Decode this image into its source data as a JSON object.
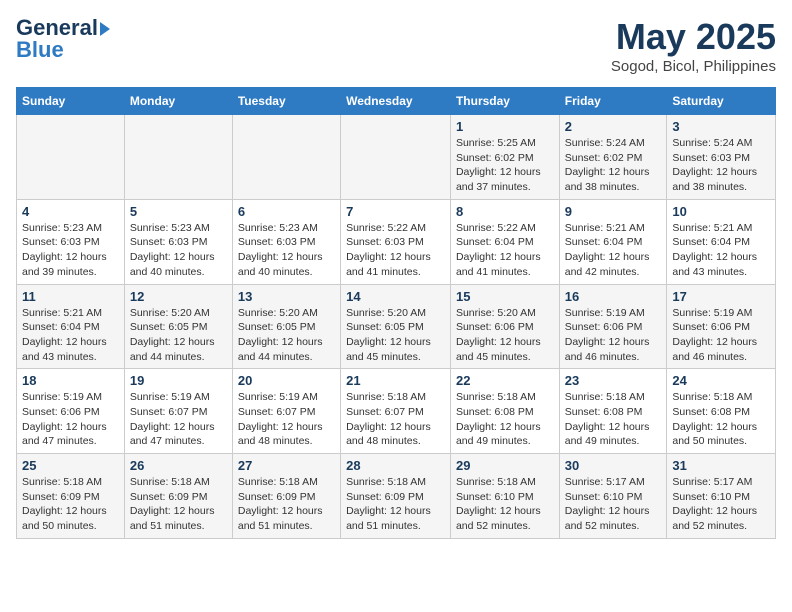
{
  "header": {
    "logo_line1": "General",
    "logo_line2": "Blue",
    "month": "May 2025",
    "location": "Sogod, Bicol, Philippines"
  },
  "weekdays": [
    "Sunday",
    "Monday",
    "Tuesday",
    "Wednesday",
    "Thursday",
    "Friday",
    "Saturday"
  ],
  "weeks": [
    [
      {
        "day": "",
        "text": ""
      },
      {
        "day": "",
        "text": ""
      },
      {
        "day": "",
        "text": ""
      },
      {
        "day": "",
        "text": ""
      },
      {
        "day": "1",
        "text": "Sunrise: 5:25 AM\nSunset: 6:02 PM\nDaylight: 12 hours\nand 37 minutes."
      },
      {
        "day": "2",
        "text": "Sunrise: 5:24 AM\nSunset: 6:02 PM\nDaylight: 12 hours\nand 38 minutes."
      },
      {
        "day": "3",
        "text": "Sunrise: 5:24 AM\nSunset: 6:03 PM\nDaylight: 12 hours\nand 38 minutes."
      }
    ],
    [
      {
        "day": "4",
        "text": "Sunrise: 5:23 AM\nSunset: 6:03 PM\nDaylight: 12 hours\nand 39 minutes."
      },
      {
        "day": "5",
        "text": "Sunrise: 5:23 AM\nSunset: 6:03 PM\nDaylight: 12 hours\nand 40 minutes."
      },
      {
        "day": "6",
        "text": "Sunrise: 5:23 AM\nSunset: 6:03 PM\nDaylight: 12 hours\nand 40 minutes."
      },
      {
        "day": "7",
        "text": "Sunrise: 5:22 AM\nSunset: 6:03 PM\nDaylight: 12 hours\nand 41 minutes."
      },
      {
        "day": "8",
        "text": "Sunrise: 5:22 AM\nSunset: 6:04 PM\nDaylight: 12 hours\nand 41 minutes."
      },
      {
        "day": "9",
        "text": "Sunrise: 5:21 AM\nSunset: 6:04 PM\nDaylight: 12 hours\nand 42 minutes."
      },
      {
        "day": "10",
        "text": "Sunrise: 5:21 AM\nSunset: 6:04 PM\nDaylight: 12 hours\nand 43 minutes."
      }
    ],
    [
      {
        "day": "11",
        "text": "Sunrise: 5:21 AM\nSunset: 6:04 PM\nDaylight: 12 hours\nand 43 minutes."
      },
      {
        "day": "12",
        "text": "Sunrise: 5:20 AM\nSunset: 6:05 PM\nDaylight: 12 hours\nand 44 minutes."
      },
      {
        "day": "13",
        "text": "Sunrise: 5:20 AM\nSunset: 6:05 PM\nDaylight: 12 hours\nand 44 minutes."
      },
      {
        "day": "14",
        "text": "Sunrise: 5:20 AM\nSunset: 6:05 PM\nDaylight: 12 hours\nand 45 minutes."
      },
      {
        "day": "15",
        "text": "Sunrise: 5:20 AM\nSunset: 6:06 PM\nDaylight: 12 hours\nand 45 minutes."
      },
      {
        "day": "16",
        "text": "Sunrise: 5:19 AM\nSunset: 6:06 PM\nDaylight: 12 hours\nand 46 minutes."
      },
      {
        "day": "17",
        "text": "Sunrise: 5:19 AM\nSunset: 6:06 PM\nDaylight: 12 hours\nand 46 minutes."
      }
    ],
    [
      {
        "day": "18",
        "text": "Sunrise: 5:19 AM\nSunset: 6:06 PM\nDaylight: 12 hours\nand 47 minutes."
      },
      {
        "day": "19",
        "text": "Sunrise: 5:19 AM\nSunset: 6:07 PM\nDaylight: 12 hours\nand 47 minutes."
      },
      {
        "day": "20",
        "text": "Sunrise: 5:19 AM\nSunset: 6:07 PM\nDaylight: 12 hours\nand 48 minutes."
      },
      {
        "day": "21",
        "text": "Sunrise: 5:18 AM\nSunset: 6:07 PM\nDaylight: 12 hours\nand 48 minutes."
      },
      {
        "day": "22",
        "text": "Sunrise: 5:18 AM\nSunset: 6:08 PM\nDaylight: 12 hours\nand 49 minutes."
      },
      {
        "day": "23",
        "text": "Sunrise: 5:18 AM\nSunset: 6:08 PM\nDaylight: 12 hours\nand 49 minutes."
      },
      {
        "day": "24",
        "text": "Sunrise: 5:18 AM\nSunset: 6:08 PM\nDaylight: 12 hours\nand 50 minutes."
      }
    ],
    [
      {
        "day": "25",
        "text": "Sunrise: 5:18 AM\nSunset: 6:09 PM\nDaylight: 12 hours\nand 50 minutes."
      },
      {
        "day": "26",
        "text": "Sunrise: 5:18 AM\nSunset: 6:09 PM\nDaylight: 12 hours\nand 51 minutes."
      },
      {
        "day": "27",
        "text": "Sunrise: 5:18 AM\nSunset: 6:09 PM\nDaylight: 12 hours\nand 51 minutes."
      },
      {
        "day": "28",
        "text": "Sunrise: 5:18 AM\nSunset: 6:09 PM\nDaylight: 12 hours\nand 51 minutes."
      },
      {
        "day": "29",
        "text": "Sunrise: 5:18 AM\nSunset: 6:10 PM\nDaylight: 12 hours\nand 52 minutes."
      },
      {
        "day": "30",
        "text": "Sunrise: 5:17 AM\nSunset: 6:10 PM\nDaylight: 12 hours\nand 52 minutes."
      },
      {
        "day": "31",
        "text": "Sunrise: 5:17 AM\nSunset: 6:10 PM\nDaylight: 12 hours\nand 52 minutes."
      }
    ]
  ]
}
